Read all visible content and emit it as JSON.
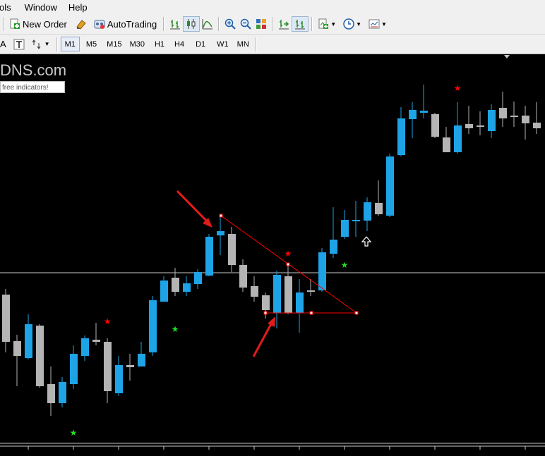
{
  "menu": {
    "items": [
      "ols",
      "Window",
      "Help"
    ]
  },
  "toolbar": {
    "new_order_label": "New Order",
    "autotrading_label": "AutoTrading",
    "left_text": "A"
  },
  "timeframes": {
    "items": [
      "M1",
      "M5",
      "M15",
      "M30",
      "H1",
      "H4",
      "D1",
      "W1",
      "MN"
    ],
    "active": "M1"
  },
  "chart": {
    "watermark": "DNS.com",
    "promo_text": "free indicators!",
    "colors": {
      "background": "#000000",
      "bull_candle": "#1ea4e6",
      "bear_candle": "#b4b4b4",
      "trendline": "#ff0000",
      "arrow": "#e31b1b",
      "star_red": "#ff0000",
      "star_green": "#22dd22",
      "horizontal_line": "#c8c8c8"
    }
  }
}
